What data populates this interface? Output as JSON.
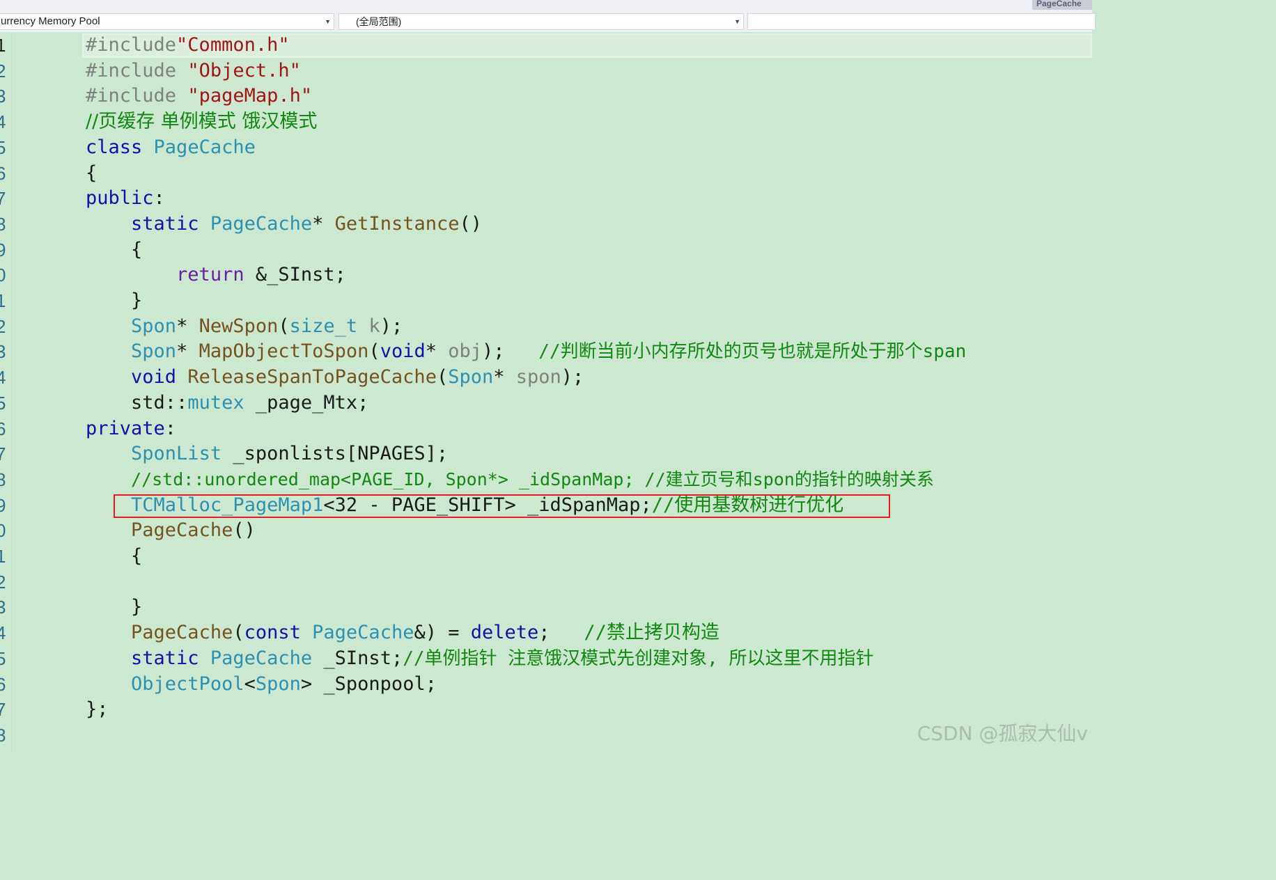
{
  "tabs": {
    "active_file": "PageCache"
  },
  "navbar": {
    "project_combo": "urrency Memory Pool",
    "scope_combo": "(全局范围)",
    "member_combo": ""
  },
  "editor": {
    "active_line": 1,
    "line_numbers": [
      "1",
      "2",
      "3",
      "4",
      "5",
      "6",
      "7",
      "8",
      "9",
      "0",
      "1",
      "2",
      "3",
      "4",
      "5",
      "6",
      "7",
      "8",
      "9",
      "0",
      "1",
      "2",
      "3",
      "4",
      "5",
      "6",
      "7",
      "8"
    ],
    "code": {
      "l1": {
        "pp": "#include",
        "str": "\"Common.h\""
      },
      "l2": {
        "pp": "#include ",
        "str": "\"Object.h\""
      },
      "l3": {
        "pp": "#include ",
        "str": "\"pageMap.h\""
      },
      "l4": {
        "cm": "//页缓存 单例模式 饿汉模式"
      },
      "l5": {
        "kw": "class",
        "sp": " ",
        "ty": "PageCache"
      },
      "l6": {
        "t": "{"
      },
      "l7": {
        "kw": "public",
        "t": ":"
      },
      "l8": {
        "ind": "    ",
        "kw": "static",
        "sp": " ",
        "ty": "PageCache",
        "t1": "* ",
        "fn": "GetInstance",
        "t2": "()"
      },
      "l9": {
        "ind": "    ",
        "t": "{"
      },
      "l10": {
        "ind": "        ",
        "kw": "return",
        "t": " &_SInst;"
      },
      "l11": {
        "ind": "    ",
        "t": "}"
      },
      "l12": {
        "ind": "    ",
        "ty": "Spon",
        "t1": "* ",
        "fn": "NewSpon",
        "t2": "(",
        "ty2": "size_t",
        "sp": " ",
        "prm": "k",
        "t3": ");"
      },
      "l13": {
        "ind": "    ",
        "ty": "Spon",
        "t1": "* ",
        "fn": "MapObjectToSpon",
        "t2": "(",
        "kw": "void",
        "t3": "* ",
        "prm": "obj",
        "t4": ");   ",
        "cm": "//判断当前小内存所处的页号也就是所处于那个span"
      },
      "l14": {
        "ind": "    ",
        "kw": "void",
        "sp": " ",
        "fn": "ReleaseSpanToPageCache",
        "t1": "(",
        "ty": "Spon",
        "t2": "* ",
        "prm": "spon",
        "t3": ");"
      },
      "l15": {
        "ind": "    ",
        "t1": "std::",
        "ty": "mutex",
        "t2": " _page_Mtx;"
      },
      "l16": {
        "kw": "private",
        "t": ":"
      },
      "l17": {
        "ind": "    ",
        "ty": "SponList",
        "t": " _sponlists[NPAGES];"
      },
      "l18": {
        "ind": "    ",
        "cm": "//std::unordered_map<PAGE_ID, Spon*> _idSpanMap; //建立页号和spon的指针的映射关系"
      },
      "l19": {
        "ind": "    ",
        "ty": "TCMalloc_PageMap1",
        "t": "<32 - PAGE_SHIFT> _idSpanMap;",
        "cm": "//使用基数树进行优化"
      },
      "l20": {
        "ind": "    ",
        "fn": "PageCache",
        "t": "()"
      },
      "l21": {
        "ind": "    ",
        "t": "{"
      },
      "l22": {
        "t": ""
      },
      "l23": {
        "ind": "    ",
        "t": "}"
      },
      "l24": {
        "ind": "    ",
        "fn": "PageCache",
        "t1": "(",
        "kw": "const",
        "sp": " ",
        "ty": "PageCache",
        "t2": "&) = ",
        "kw2": "delete",
        "t3": ";   ",
        "cm": "//禁止拷贝构造"
      },
      "l25": {
        "ind": "    ",
        "kw": "static",
        "sp": " ",
        "ty": "PageCache",
        "t": " _SInst;",
        "cm": "//单例指针 注意饿汉模式先创建对象, 所以这里不用指针"
      },
      "l26": {
        "ind": "    ",
        "ty": "ObjectPool",
        "t1": "<",
        "ty2": "Spon",
        "t2": "> _Sponpool;"
      },
      "l27": {
        "t": "};"
      },
      "l28": {
        "t": ""
      }
    }
  },
  "watermark": "CSDN @孤寂大仙v",
  "colors": {
    "editor_bg": "#cde8d0",
    "keyword": "#1111aa",
    "type": "#2b91af",
    "function": "#74531f",
    "string": "#a31515",
    "comment": "#118811",
    "highlight_box": "#e02020"
  }
}
